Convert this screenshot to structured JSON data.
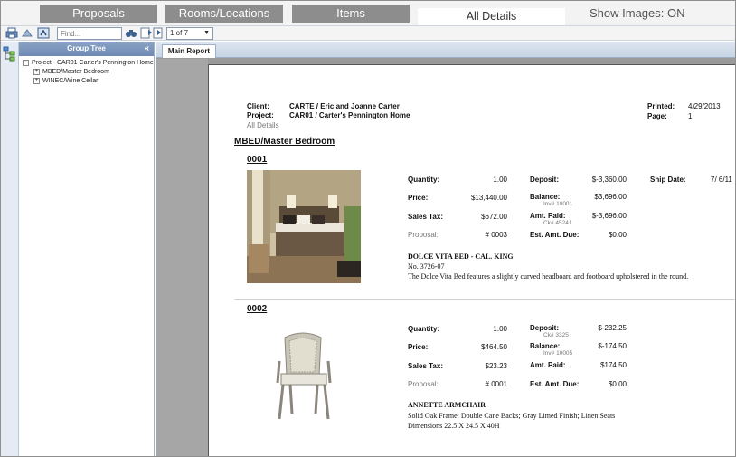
{
  "tabs": {
    "proposals": "Proposals",
    "rooms": "Rooms/Locations",
    "items": "Items",
    "all_details": "All Details",
    "show_images": "Show Images: ON"
  },
  "toolbar": {
    "find_placeholder": "Find...",
    "page_indicator": "1 of 7"
  },
  "group_tree": {
    "title": "Group Tree",
    "collapse": "«",
    "root": "Project - CAR01 Carter's Pennington Home",
    "children": [
      "MBED/Master Bedroom",
      "WINEC/Wine Cellar"
    ]
  },
  "report": {
    "tab": "Main Report",
    "client_label": "Client:",
    "client_value": "CARTE / Eric and Joanne Carter",
    "project_label": "Project:",
    "project_value": "CAR01 / Carter's Pennington Home",
    "subtitle": "All Details",
    "printed_label": "Printed:",
    "printed_value": "4/29/2013",
    "page_label": "Page:",
    "page_value": "1",
    "room": "MBED/Master Bedroom",
    "items": [
      {
        "number": "0001",
        "quantity_label": "Quantity:",
        "quantity": "1.00",
        "price_label": "Price:",
        "price": "$13,440.00",
        "tax_label": "Sales Tax:",
        "tax": "$672.00",
        "proposal_label": "Proposal:",
        "proposal": "# 0003",
        "deposit_label": "Deposit:",
        "deposit": "$-3,360.00",
        "deposit_ref": "",
        "balance_label": "Balance:",
        "balance": "$3,696.00",
        "balance_ref": "Inv# 10001",
        "paid_label": "Amt. Paid:",
        "paid": "$-3,696.00",
        "paid_ref": "Ck# 45241",
        "due_label": "Est. Amt. Due:",
        "due": "$0.00",
        "ship_label": "Ship Date:",
        "ship": "7/ 6/11",
        "name": "DOLCE VITA BED - CAL. KING",
        "desc1": "No. 3726-07",
        "desc2": "The Dolce Vita Bed features a slightly curved headboard and footboard upholstered in the round.",
        "desc3": ""
      },
      {
        "number": "0002",
        "quantity_label": "Quantity:",
        "quantity": "1.00",
        "price_label": "Price:",
        "price": "$464.50",
        "tax_label": "Sales Tax:",
        "tax": "$23.23",
        "proposal_label": "Proposal:",
        "proposal": "# 0001",
        "deposit_label": "Deposit:",
        "deposit": "$-232.25",
        "deposit_ref": "Ck# 3325",
        "balance_label": "Balance:",
        "balance": "$-174.50",
        "balance_ref": "Inv# 10005",
        "paid_label": "Amt. Paid:",
        "paid": "$174.50",
        "paid_ref": "",
        "due_label": "Est. Amt. Due:",
        "due": "$0.00",
        "ship_label": "",
        "ship": "",
        "name": "ANNETTE ARMCHAIR",
        "desc1": "Solid Oak Frame; Double Cane Backs; Gray Limed Finish; Linen Seats",
        "desc2": "Dimensions 22.5 X 24.5 X 40H",
        "desc3": ""
      }
    ]
  }
}
